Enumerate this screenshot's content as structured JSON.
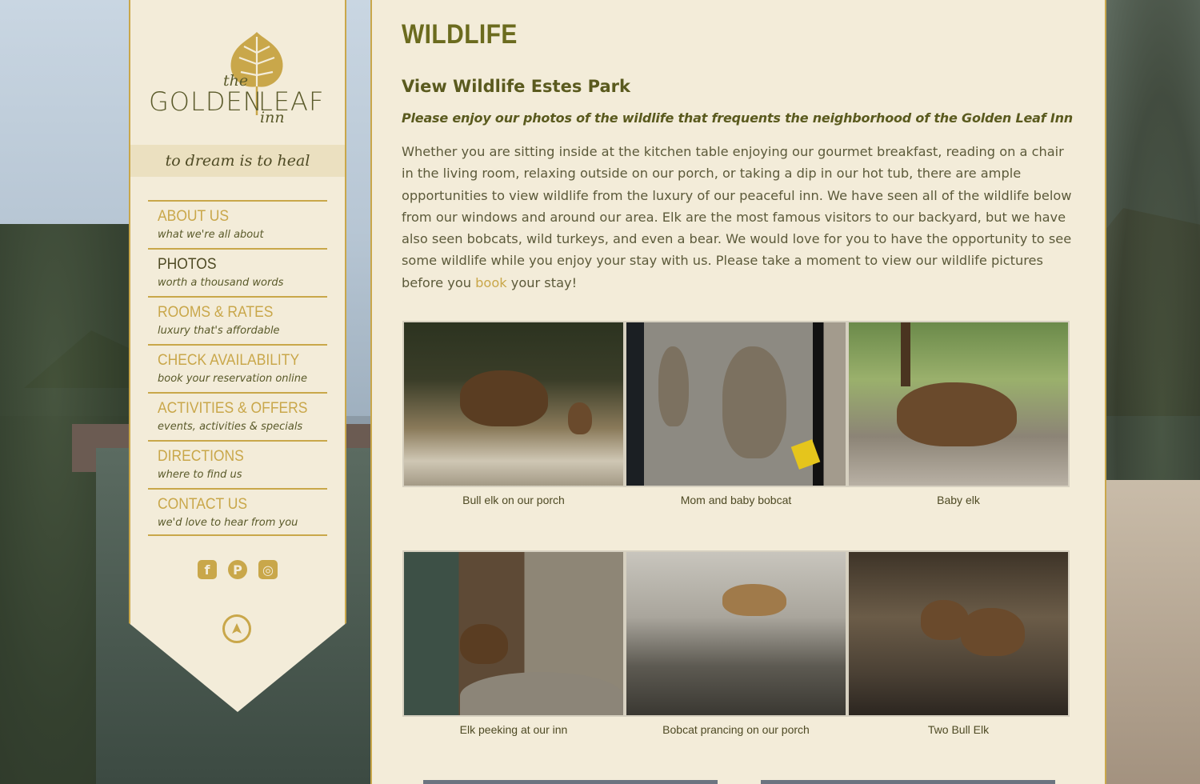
{
  "brand": {
    "logo_the": "the",
    "logo_golden": "GOLDEN",
    "logo_leaf": "LEAF",
    "logo_inn": "inn",
    "tagline": "to dream is to heal",
    "accent_color": "#c9a74a",
    "text_color": "#4e4a24",
    "panel_color": "#f3ecd9"
  },
  "nav": {
    "items": [
      {
        "title": "ABOUT US",
        "sub": "what we're all about"
      },
      {
        "title": "PHOTOS",
        "sub": "worth a thousand words"
      },
      {
        "title": "ROOMS & RATES",
        "sub": "luxury that's affordable"
      },
      {
        "title": "CHECK AVAILABILITY",
        "sub": "book your reservation online"
      },
      {
        "title": "ACTIVITIES & OFFERS",
        "sub": "events, activities & specials"
      },
      {
        "title": "DIRECTIONS",
        "sub": "where to find us"
      },
      {
        "title": "CONTACT US",
        "sub": "we'd love to hear from you"
      }
    ]
  },
  "social": {
    "facebook_icon": "f",
    "pinterest_icon": "P",
    "instagram_icon": "◎"
  },
  "page": {
    "title": "WILDLIFE",
    "subheading": "View Wildlife Estes Park",
    "lead": "Please enjoy our photos of the wildlife that frequents the neighborhood of the Golden Leaf Inn",
    "body_before_link": "Whether you are sitting inside at the kitchen table enjoying our gourmet breakfast, reading on a chair in the living room, relaxing outside on our porch, or taking a dip in our hot tub, there are ample opportunities to view wildlife from the luxury of our peaceful inn. We have seen all of the wildlife below from our windows and around our area. Elk are the most famous visitors to our backyard, but we have also seen bobcats, wild turkeys, and even a bear. We would love for you to have the opportunity to see some wildlife while you enjoy your stay with us. Please take a moment to view our wildlife pictures before you",
    "body_link": "book",
    "body_after_link": "your stay!"
  },
  "gallery": {
    "captions": [
      "Bull elk on our porch",
      "Mom and baby bobcat",
      "Baby elk",
      "Elk peeking at our inn",
      "Bobcat prancing on our porch",
      "Two Bull Elk"
    ]
  }
}
